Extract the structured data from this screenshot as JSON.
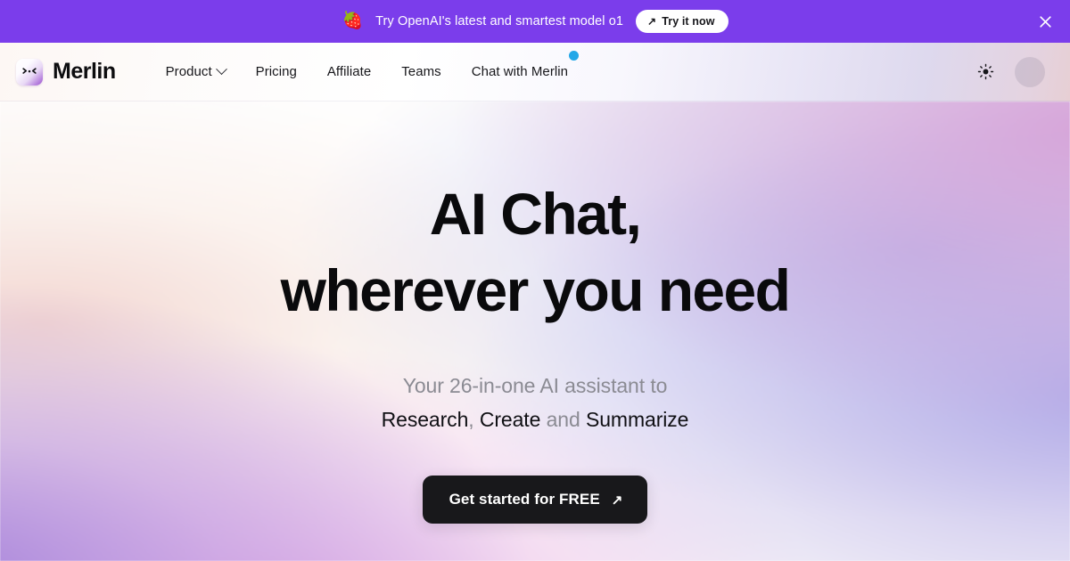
{
  "promo_banner": {
    "emoji": "🍓",
    "emoji_name": "strawberry-emoji",
    "message": "Try OpenAI's latest and smartest model o1",
    "cta_label": "Try it now",
    "cta_arrow": "↗",
    "close_label": "×",
    "background_color": "#7B3DEB",
    "cta_background": "#FFFFFF",
    "cta_text_color": "#16161A"
  },
  "navbar": {
    "brand": {
      "name": "Merlin",
      "logo_face": "&gt;.&lt;",
      "logo_gradient_from": "#FFFFFF",
      "logo_gradient_to": "#9A4FD0"
    },
    "links": [
      {
        "label": "Product",
        "has_dropdown": true,
        "badge": false
      },
      {
        "label": "Pricing",
        "has_dropdown": false,
        "badge": false
      },
      {
        "label": "Affiliate",
        "has_dropdown": false,
        "badge": false
      },
      {
        "label": "Teams",
        "has_dropdown": false,
        "badge": false
      },
      {
        "label": "Chat with Merlin",
        "has_dropdown": false,
        "badge": true
      }
    ],
    "badge_color": "#22A7E8",
    "theme_toggle": {
      "icon": "sun-icon",
      "mode": "light"
    },
    "avatar": {
      "label": ""
    }
  },
  "hero": {
    "headline_line1": "AI Chat,",
    "headline_line2": "wherever you need",
    "subhead_line1": "Your 26-in-one AI assistant to",
    "keyword_1": "Research",
    "keyword_sep_1": ",",
    "keyword_2": "Create",
    "keyword_sep_2": "and",
    "keyword_3": "Summarize",
    "cta_label": "Get started for FREE",
    "cta_arrow": "↗",
    "cta_background": "#18181B",
    "cta_text_color": "#FFFFFF",
    "headline_color": "#0A0A0C",
    "subhead_color": "#8B8B93"
  }
}
